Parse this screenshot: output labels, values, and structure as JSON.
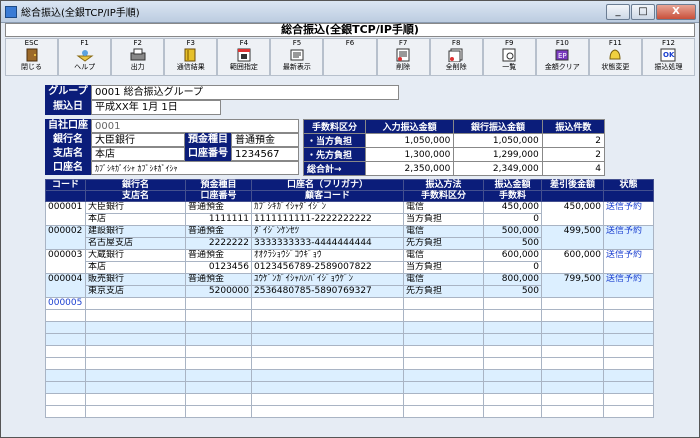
{
  "window": {
    "title": "総合振込(全銀TCP/IP手順)",
    "buttons": [
      "_",
      "□",
      "X"
    ]
  },
  "header": "総合振込(全銀TCP/IP手順)",
  "fkeys": [
    {
      "key": "ESC",
      "label": "閉じる",
      "icon": "door-icon"
    },
    {
      "key": "F1",
      "label": "ヘルプ",
      "icon": "help-icon"
    },
    {
      "key": "F2",
      "label": "出力",
      "icon": "printer-icon"
    },
    {
      "key": "F3",
      "label": "通信結果",
      "icon": "book-icon"
    },
    {
      "key": "F4",
      "label": "範囲指定",
      "icon": "calendar-icon"
    },
    {
      "key": "F5",
      "label": "最新表示",
      "icon": "refresh-icon"
    },
    {
      "key": "F6",
      "label": "",
      "icon": ""
    },
    {
      "key": "F7",
      "label": "削除",
      "icon": "delete-icon"
    },
    {
      "key": "F8",
      "label": "全削除",
      "icon": "delete-all-icon"
    },
    {
      "key": "F9",
      "label": "一覧",
      "icon": "search-icon"
    },
    {
      "key": "F10",
      "label": "金額クリア",
      "icon": "clear-icon"
    },
    {
      "key": "F11",
      "label": "状態変更",
      "icon": "bell-icon"
    },
    {
      "key": "F12",
      "label": "振込処理",
      "icon": "ok-icon"
    }
  ],
  "group": {
    "label": "グループ",
    "value": "0001 総合振込グループ"
  },
  "transfer_date": {
    "label": "振込日",
    "value": "平成XX年 1月 1日"
  },
  "own_account": {
    "code_label": "自社口座",
    "code": "0001",
    "bank_label": "銀行名",
    "bank": "大臣銀行",
    "deposit_label": "預金種目",
    "deposit": "普通預金",
    "branch_label": "支店名",
    "branch": "本店",
    "acct_no_label": "口座番号",
    "acct_no": "1234567",
    "name_label": "口座名",
    "name": "ｶﾌﾞｼｷｶﾞｲｼｬ ｶﾌﾞｼｷｶﾞｲｼｬ"
  },
  "fees": {
    "headers": [
      "手数料区分",
      "入力振込金額",
      "銀行振込金額",
      "振込件数"
    ],
    "rows": [
      {
        "label": "・当方負担",
        "input": "1,050,000",
        "bank": "1,050,000",
        "count": "2"
      },
      {
        "label": "・先方負担",
        "input": "1,300,000",
        "bank": "1,299,000",
        "count": "2"
      },
      {
        "label": "総合計→",
        "input": "2,350,000",
        "bank": "2,349,000",
        "count": "4"
      }
    ]
  },
  "grid": {
    "headers1": [
      "コード",
      "銀行名",
      "預金種目",
      "口座名（フリガナ）",
      "振込方法",
      "振込金額",
      "差引後金額",
      "状態"
    ],
    "headers2": [
      "",
      "支店名",
      "口座番号",
      "顧客コード",
      "手数料区分",
      "手数料",
      "",
      ""
    ],
    "rows": [
      {
        "code": "000001",
        "bank": "大臣銀行",
        "branch": "本店",
        "deposit": "普通預金",
        "acct": "1111111",
        "kana": "ｶﾌﾞｼｷｶﾞｲｼｬﾀﾞｲｼﾞﾝ",
        "cust": "1111111111-2222222222",
        "method": "電信",
        "fee_div": "当方負担",
        "amount": "450,000",
        "fee": "0",
        "net": "450,000",
        "status": "送信予約"
      },
      {
        "code": "000002",
        "bank": "建設銀行",
        "branch": "名古屋支店",
        "deposit": "普通預金",
        "acct": "2222222",
        "kana": "ﾀﾞｲｼﾞﾝｹﾝｾﾂ",
        "cust": "3333333333-4444444444",
        "method": "電信",
        "fee_div": "先方負担",
        "amount": "500,000",
        "fee": "500",
        "net": "499,500",
        "status": "送信予約"
      },
      {
        "code": "000003",
        "bank": "大蔵銀行",
        "branch": "本店",
        "deposit": "普通預金",
        "acct": "0123456",
        "kana": "ｵｵｸﾗｼｮｳｼﾞｺｳｷﾞｮｳ",
        "cust": "0123456789-2589007822",
        "method": "電信",
        "fee_div": "当方負担",
        "amount": "600,000",
        "fee": "0",
        "net": "600,000",
        "status": "送信予約"
      },
      {
        "code": "000004",
        "bank": "販売銀行",
        "branch": "東京支店",
        "deposit": "普通預金",
        "acct": "5200000",
        "kana": "ﾕｳｹﾞﾝｶﾞｲｼｬﾊﾝﾊﾞｲｼﾞｮｳｹﾞﾝ",
        "cust": "2536480785-5890769327",
        "method": "電信",
        "fee_div": "先方負担",
        "amount": "800,000",
        "fee": "500",
        "net": "799,500",
        "status": "送信予約"
      }
    ],
    "new_code": "000005"
  },
  "colors": {
    "header_blue": "#0b1d7a",
    "row_alt": "#dcefff",
    "status_text": "#1a3fd0",
    "selected": "#ffff00"
  }
}
